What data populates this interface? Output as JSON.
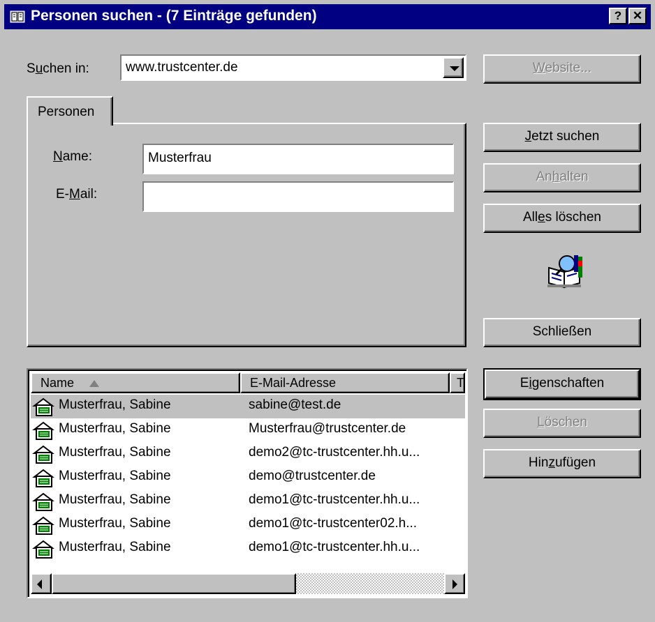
{
  "window": {
    "title": "Personen suchen - (7 Einträge gefunden)",
    "help_button": "?",
    "close_button": "✕"
  },
  "search_in": {
    "label_pre": "S",
    "label_u": "u",
    "label_post": "chen in:",
    "value": "www.trustcenter.de"
  },
  "tab": {
    "label": "Personen"
  },
  "form": {
    "name_label_u": "N",
    "name_label_post": "ame:",
    "name_value": "Musterfrau",
    "email_label_pre": "E-",
    "email_label_u": "M",
    "email_label_post": "ail:",
    "email_value": ""
  },
  "buttons": {
    "website_u": "W",
    "website_post": "ebsite...",
    "search_u": "J",
    "search_post": "etzt suchen",
    "stop_pre": "An",
    "stop_u": "h",
    "stop_post": "alten",
    "clear_pre": "All",
    "clear_u": "e",
    "clear_post": "s löschen",
    "close_label": "Schließen",
    "properties_pre": "E",
    "properties_u": "i",
    "properties_post": "genschaften",
    "delete_u": "L",
    "delete_post": "öschen",
    "add_pre": "Hin",
    "add_u": "z",
    "add_post": "ufügen"
  },
  "list": {
    "columns": [
      "Name",
      "E-Mail-Adresse",
      "T"
    ],
    "rows": [
      {
        "name": "Musterfrau, Sabine",
        "email": "sabine@test.de"
      },
      {
        "name": "Musterfrau, Sabine",
        "email": "Musterfrau@trustcenter.de"
      },
      {
        "name": "Musterfrau, Sabine",
        "email": "demo2@tc-trustcenter.hh.u..."
      },
      {
        "name": "Musterfrau, Sabine",
        "email": "demo@trustcenter.de"
      },
      {
        "name": "Musterfrau, Sabine",
        "email": "demo1@tc-trustcenter.hh.u..."
      },
      {
        "name": "Musterfrau, Sabine",
        "email": "demo1@tc-trustcenter02.h..."
      },
      {
        "name": "Musterfrau, Sabine",
        "email": "demo1@tc-trustcenter.hh.u..."
      }
    ]
  },
  "colors": {
    "titlebar": "#000080",
    "face": "#c0c0c0",
    "selected_row": "#c0c0c0"
  },
  "icons": {
    "window": "address-book-icon",
    "search_graphic": "book-magnifier-icon",
    "contact": "contact-card-icon"
  }
}
